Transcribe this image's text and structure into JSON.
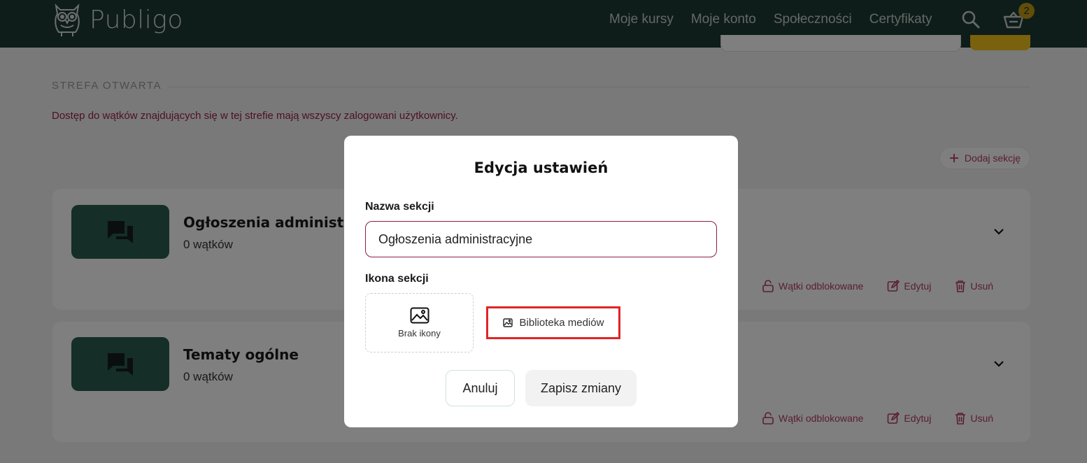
{
  "header": {
    "brand": "Publigo",
    "nav": [
      "Moje kursy",
      "Moje konto",
      "Społeczności",
      "Certyfikaty"
    ],
    "cart_count": "2",
    "colors": {
      "bar": "#1c3b33",
      "badge": "#c59a12"
    }
  },
  "zone": {
    "title": "STREFA OTWARTA",
    "description": "Dostęp do wątków znajdujących się w tej strefie mają wszyscy zalogowani użytkownicy.",
    "add_section": "Dodaj sekcję"
  },
  "sections": [
    {
      "title": "Ogłoszenia administracyjne",
      "count": "0 wątków"
    },
    {
      "title": "Tematy ogólne",
      "count": "0 wątków"
    }
  ],
  "actions": {
    "unlocked": "Wątki odblokowane",
    "edit": "Edytuj",
    "delete": "Usuń"
  },
  "modal": {
    "title": "Edycja ustawień",
    "name_label": "Nazwa sekcji",
    "name_value": "Ogłoszenia administracyjne",
    "icon_label": "Ikona sekcji",
    "no_icon": "Brak ikony",
    "media_library": "Biblioteka mediów",
    "cancel": "Anuluj",
    "save": "Zapisz zmiany"
  }
}
